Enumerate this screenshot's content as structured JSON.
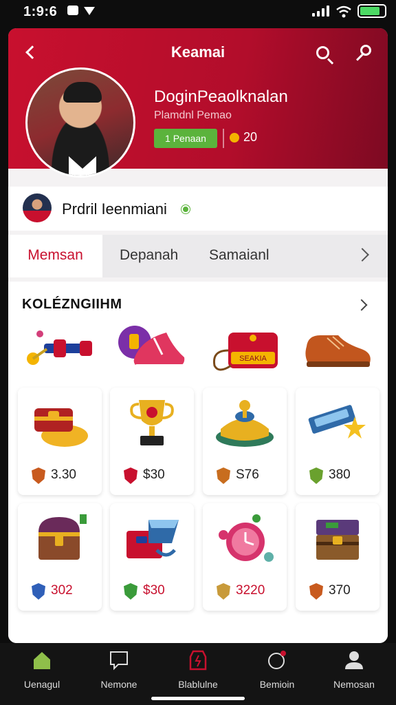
{
  "status_bar": {
    "time": "1:9:6"
  },
  "header": {
    "title": "Keamai",
    "name": "DoginPeaolknalan",
    "subtitle": "Plamdnl Pemao",
    "plan_badge": "1 Penaan",
    "coins": "20",
    "colors": {
      "hero": "#c8102e",
      "badge": "#5bb33c",
      "coin": "#f4b400"
    }
  },
  "profile": {
    "name": "Prdril Ieenmiani"
  },
  "tabs": [
    {
      "label": "Memsan",
      "active": true
    },
    {
      "label": "Depanah",
      "active": false
    },
    {
      "label": "Samaianl",
      "active": false
    }
  ],
  "collection": {
    "title": "KOLÉZNGIIHM",
    "top_items": [
      {
        "icon": "dumbbell-icon"
      },
      {
        "icon": "sneaker-icon"
      },
      {
        "icon": "bag-icon",
        "label": "SEAKIA"
      },
      {
        "icon": "shoe-icon"
      }
    ],
    "items": [
      {
        "icon": "treasure-chest-icon",
        "price": "3.30",
        "shield_color": "#c85a1e",
        "price_color": "#222222"
      },
      {
        "icon": "trophy-icon",
        "price": "$30",
        "shield_color": "#c8102e",
        "price_color": "#222222"
      },
      {
        "icon": "button-icon",
        "price": "S76",
        "shield_color": "#c86d1e",
        "price_color": "#222222"
      },
      {
        "icon": "ticket-icon",
        "price": "380",
        "shield_color": "#6aa12e",
        "price_color": "#222222"
      },
      {
        "icon": "chest-icon",
        "price": "302",
        "shield_color": "#2f5fb8",
        "price_color": "#c8102e"
      },
      {
        "icon": "box-icon",
        "price": "$30",
        "shield_color": "#3a9b3a",
        "price_color": "#c8102e"
      },
      {
        "icon": "clock-icon",
        "price": "3220",
        "shield_color": "#c89a3a",
        "price_color": "#c8102e"
      },
      {
        "icon": "crate-icon",
        "price": "370",
        "shield_color": "#c85a1e",
        "price_color": "#222222"
      }
    ]
  },
  "bottom_nav": [
    {
      "label": "Uenagul",
      "icon": "home-icon",
      "color": "#8fbf4a"
    },
    {
      "label": "Nemone",
      "icon": "chat-icon",
      "color": "#dddddd"
    },
    {
      "label": "Blablulne",
      "icon": "tag-icon",
      "color": "#c8102e"
    },
    {
      "label": "Bemioin",
      "icon": "notification-icon",
      "color": "#dddddd"
    },
    {
      "label": "Nemosan",
      "icon": "user-icon",
      "color": "#dddddd"
    }
  ]
}
